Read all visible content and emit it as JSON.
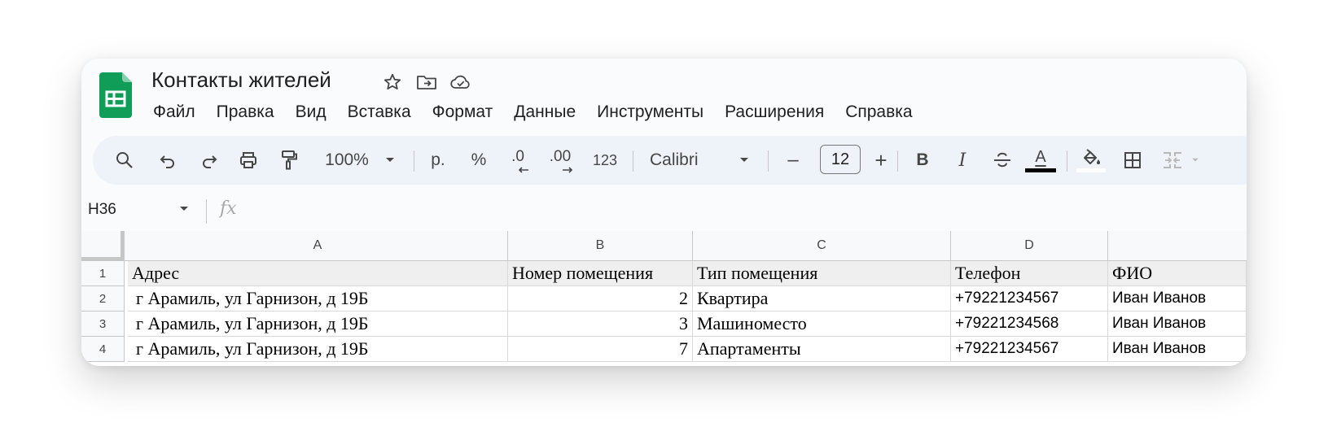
{
  "doc": {
    "title": "Контакты жителей"
  },
  "menu": [
    "Файл",
    "Правка",
    "Вид",
    "Вставка",
    "Формат",
    "Данные",
    "Инструменты",
    "Расширения",
    "Справка"
  ],
  "toolbar": {
    "zoom": "100%",
    "currency": "р.",
    "percent": "%",
    "decrease_decimals": ".0",
    "increase_decimals": ".00",
    "number_format": "123",
    "font": "Calibri",
    "minus": "–",
    "font_size": "12",
    "plus": "+",
    "bold": "B",
    "italic": "I",
    "text_color_letter": "A",
    "text_color": "#000000"
  },
  "formula_bar": {
    "cell_ref": "H36",
    "fx": "fx"
  },
  "sheet": {
    "columns": [
      "A",
      "B",
      "C",
      "D"
    ],
    "row_numbers": [
      "1",
      "2",
      "3",
      "4"
    ],
    "rows": [
      [
        "Адрес",
        "Номер помещения",
        "Тип помещения",
        "Телефон",
        "ФИО"
      ],
      [
        "г Арамиль, ул Гарнизон, д 19Б",
        "2",
        "Квартира",
        "+79221234567",
        "Иван Иванов"
      ],
      [
        "г Арамиль, ул Гарнизон, д 19Б",
        "3",
        "Машиноместо",
        "+79221234568",
        "Иван Иванов"
      ],
      [
        "г Арамиль, ул Гарнизон, д 19Б",
        "7",
        "Апартаменты",
        "+79221234567",
        "Иван Иванов"
      ]
    ]
  },
  "colors": {
    "logo_green": "#0f9d58",
    "toolbar_bg": "#eef2f9",
    "header_row_bg": "#efefef"
  }
}
